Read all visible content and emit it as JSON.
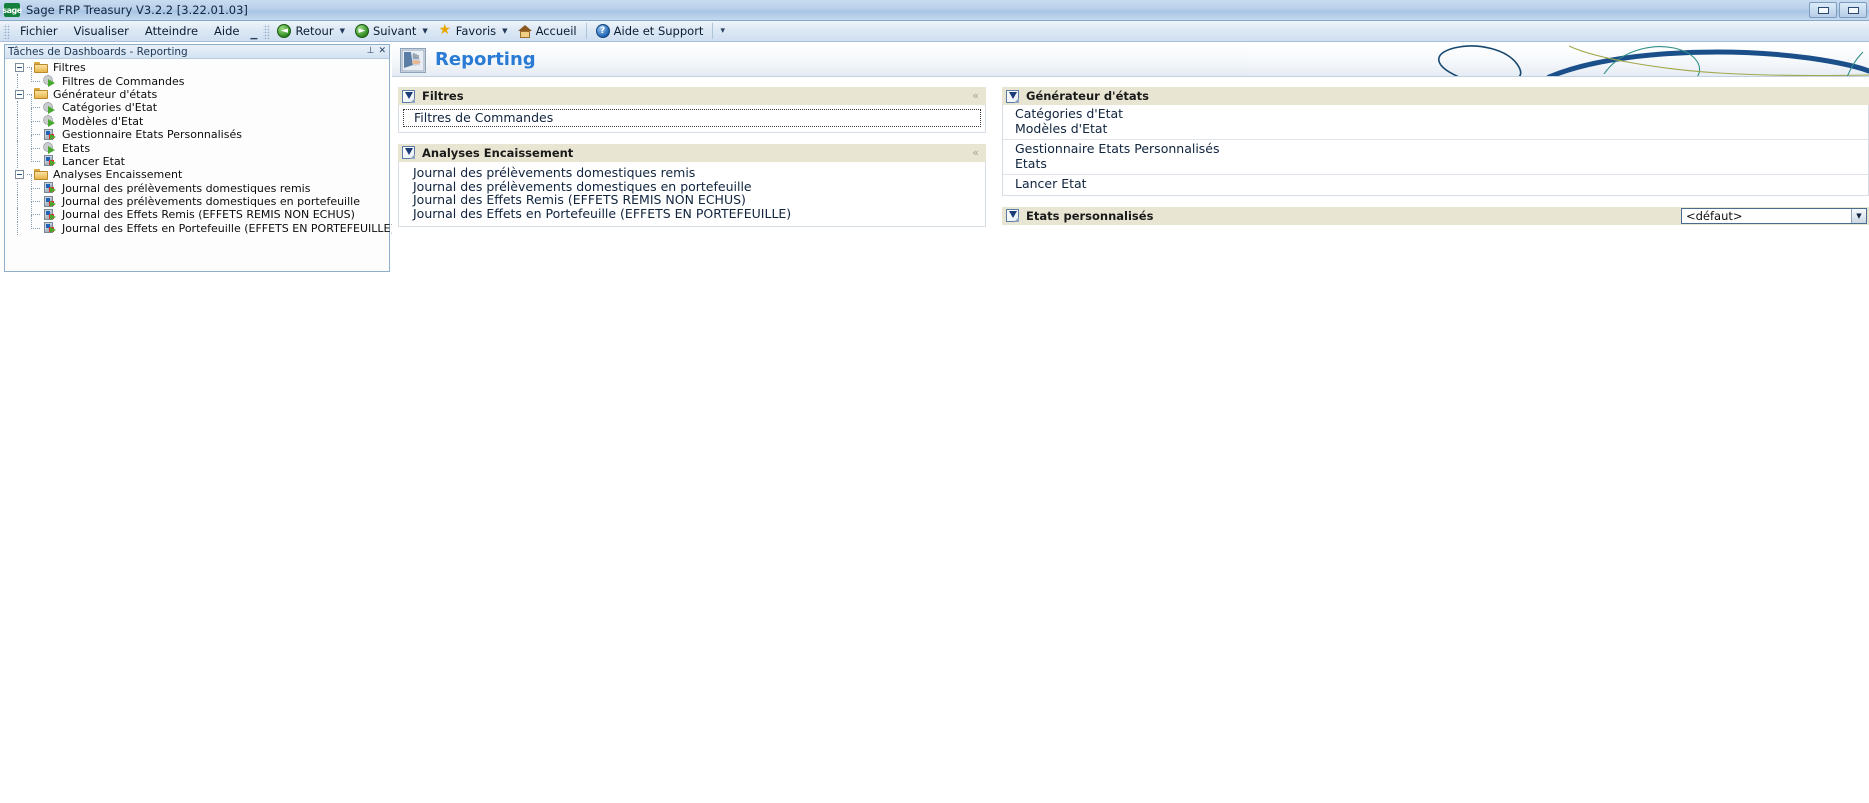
{
  "window": {
    "app_icon": "sage-logo",
    "title": "Sage FRP Treasury V3.2.2  [3.22.01.03]",
    "buttons": [
      {
        "name": "restore-window-button",
        "glyph": "restore"
      },
      {
        "name": "maximize-window-button",
        "glyph": "maximize"
      }
    ]
  },
  "menu": {
    "items": [
      {
        "label": "Fichier",
        "name": "menu-fichier"
      },
      {
        "label": "Visualiser",
        "name": "menu-visualiser"
      },
      {
        "label": "Atteindre",
        "name": "menu-atteindre"
      },
      {
        "label": "Aide",
        "name": "menu-aide"
      }
    ]
  },
  "toolbar": {
    "items": [
      {
        "label": "Retour",
        "icon": "back-arrow-icon",
        "dropdown": true
      },
      {
        "label": "Suivant",
        "icon": "forward-arrow-icon",
        "dropdown": true
      },
      {
        "label": "Favoris",
        "icon": "star-icon",
        "dropdown": true
      },
      {
        "label": "Accueil",
        "icon": "home-icon",
        "dropdown": false
      },
      {
        "label": "Aide et Support",
        "icon": "help-icon",
        "dropdown": false
      }
    ]
  },
  "left_panel": {
    "caption": "Tâches de Dashboards - Reporting",
    "pin_icon": "pin-icon",
    "close_icon": "close-icon",
    "tree": [
      {
        "label": "Filtres",
        "icon": "folder-icon",
        "level": 0,
        "expander": "minus"
      },
      {
        "label": "Filtres de Commandes",
        "icon": "gear-arrow-icon",
        "level": 1
      },
      {
        "label": "Générateur d'états",
        "icon": "folder-icon",
        "level": 0,
        "expander": "minus"
      },
      {
        "label": "Catégories d'Etat",
        "icon": "gear-arrow-icon",
        "level": 1
      },
      {
        "label": "Modèles d'Etat",
        "icon": "gear-arrow-icon",
        "level": 1
      },
      {
        "label": "Gestionnaire Etats Personnalisés",
        "icon": "report-icon",
        "level": 1
      },
      {
        "label": "Etats",
        "icon": "gear-arrow-icon",
        "level": 1
      },
      {
        "label": "Lancer Etat",
        "icon": "report-icon",
        "level": 1
      },
      {
        "label": "Analyses Encaissement",
        "icon": "folder-icon",
        "level": 0,
        "expander": "minus"
      },
      {
        "label": "Journal des prélèvements domestiques remis",
        "icon": "report-icon",
        "level": 1
      },
      {
        "label": "Journal des prélèvements domestiques en portefeuille",
        "icon": "report-icon",
        "level": 1
      },
      {
        "label": "Journal des Effets Remis (EFFETS REMIS NON ECHUS)",
        "icon": "report-icon",
        "level": 1
      },
      {
        "label": "Journal des Effets en Portefeuille (EFFETS EN PORTEFEUILLE)",
        "icon": "report-icon",
        "level": 1
      }
    ]
  },
  "content": {
    "header_icon": "reporting-icon",
    "title": "Reporting",
    "accent_color": "#2a7bd4",
    "section_header_color": "#e9e5d3"
  },
  "sections": {
    "filtres": {
      "title": "Filtres",
      "icon": "panel-icon",
      "collapse_icon": "chevron-up-icon",
      "links": [
        "Filtres de Commandes"
      ]
    },
    "analyses": {
      "title": "Analyses Encaissement",
      "icon": "panel-icon",
      "collapse_icon": "chevron-up-icon",
      "links": [
        "Journal des prélèvements domestiques remis",
        "Journal des prélèvements domestiques en portefeuille",
        "Journal des Effets Remis (EFFETS REMIS NON ECHUS)",
        "Journal des Effets en Portefeuille (EFFETS EN PORTEFEUILLE)"
      ]
    },
    "generateur": {
      "title": "Générateur d'états",
      "icon": "panel-icon",
      "groups": [
        [
          "Catégories d'Etat",
          "Modèles d'Etat"
        ],
        [
          "Gestionnaire Etats Personnalisés",
          "Etats"
        ],
        [
          "Lancer Etat"
        ]
      ]
    },
    "etats_personnalises": {
      "title": "Etats personnalisés",
      "icon": "panel-icon",
      "select_value": "<défaut>",
      "select_arrow_icon": "chevron-down-icon"
    }
  }
}
